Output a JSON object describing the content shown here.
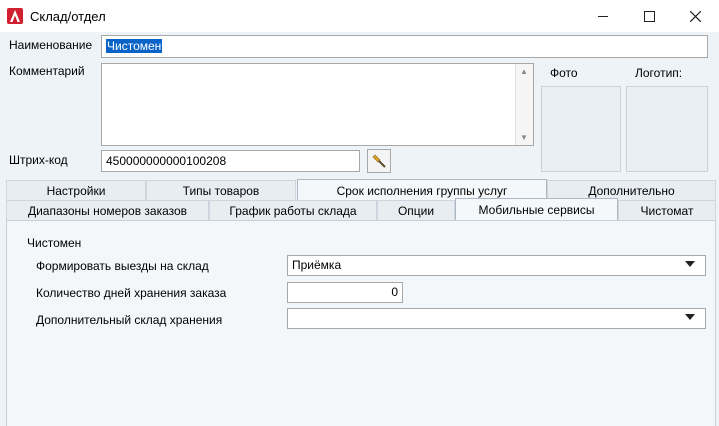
{
  "window": {
    "title": "Склад/отдел",
    "minimize": "—",
    "maximize": "☐",
    "close": "✕"
  },
  "form": {
    "name_label": "Наименование",
    "name_value": "Чистомен",
    "comment_label": "Комментарий",
    "comment_value": "",
    "barcode_label": "Штрих-код",
    "barcode_value": "450000000000100208",
    "photo_label": "Фото",
    "logo_label": "Логотип:"
  },
  "tabs_row1": [
    {
      "label": "Настройки"
    },
    {
      "label": "Типы товаров"
    },
    {
      "label": "Срок исполнения группы услуг"
    },
    {
      "label": "Дополнительно"
    }
  ],
  "tabs_row2": [
    {
      "label": "Диапазоны номеров заказов"
    },
    {
      "label": "График работы склада"
    },
    {
      "label": "Опции"
    },
    {
      "label": "Мобильные сервисы"
    },
    {
      "label": "Чистомат"
    }
  ],
  "active_tab": "Мобильные сервисы",
  "panel": {
    "group_title": "Чистомен",
    "trips_label": "Формировать выезды на склад",
    "trips_value": "Приёмка",
    "days_label": "Количество дней хранения заказа",
    "days_value": "0",
    "extra_label": "Дополнительный склад хранения",
    "extra_value": ""
  },
  "colors": {
    "selection": "#0a64c8",
    "logo_red": "#d01f2e"
  },
  "icons": [
    "app-logo-icon",
    "minimize-icon",
    "maximize-icon",
    "close-icon",
    "barcode-generate-icon",
    "chevron-down-icon"
  ]
}
